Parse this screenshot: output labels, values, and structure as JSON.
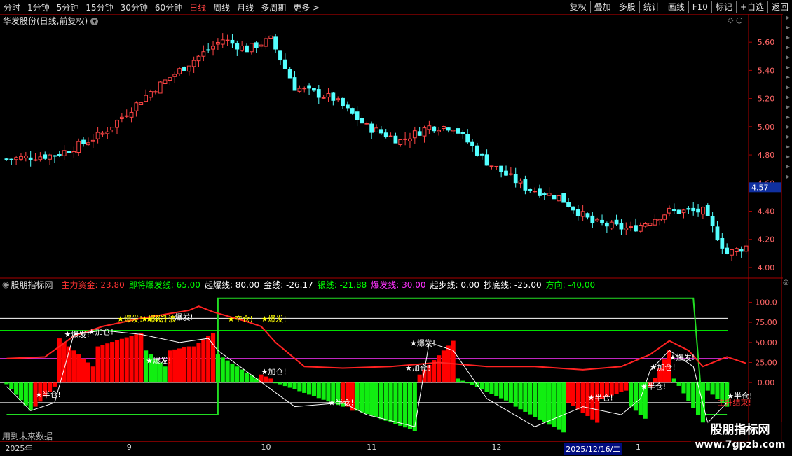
{
  "toolbar": {
    "periods": [
      "分时",
      "1分钟",
      "5分钟",
      "15分钟",
      "30分钟",
      "60分钟",
      "日线",
      "周线",
      "月线",
      "多周期",
      "更多 >"
    ],
    "active_period": "日线",
    "buttons": [
      "复权",
      "叠加",
      "多股",
      "统计",
      "画线",
      "F10",
      "标记",
      "+自选",
      "返回"
    ]
  },
  "kline": {
    "title": "华发股份(日线,前复权)",
    "price_axis": [
      "5.60",
      "5.40",
      "5.20",
      "5.00",
      "4.80",
      "4.60",
      "4.40",
      "4.20",
      "4.00"
    ],
    "current_price": "4.57",
    "ylim": [
      3.95,
      5.75
    ],
    "up_color": "#ff4444",
    "down_color": "#54ffff"
  },
  "indicator": {
    "name": "股朋指标网",
    "values": [
      {
        "label": "主力资金: 23.80",
        "color": "#ff3333"
      },
      {
        "label": "即将爆发线: 65.00",
        "color": "#00ff00"
      },
      {
        "label": "起爆线: 80.00",
        "color": "#ffffff"
      },
      {
        "label": "金线: -26.17",
        "color": "#ffffff"
      },
      {
        "label": "银线: -21.88",
        "color": "#00ff00"
      },
      {
        "label": "爆发线: 30.00",
        "color": "#ff33ff"
      },
      {
        "label": "起步线: 0.00",
        "color": "#ffffff"
      },
      {
        "label": "抄底线: -25.00",
        "color": "#ffffff"
      },
      {
        "label": "方向: -40.00",
        "color": "#00ff00"
      }
    ],
    "axis": [
      "100.0",
      "75.00",
      "50.00",
      "25.00",
      "0.00"
    ],
    "ylim": [
      -60,
      110
    ],
    "signals": [
      {
        "text": "★半仓!",
        "bar": 6,
        "v": -18,
        "color": "#ffffff"
      },
      {
        "text": "★爆发!",
        "bar": 12,
        "v": 57,
        "color": "#ffffff"
      },
      {
        "text": "★加仓!",
        "bar": 17,
        "v": 60,
        "color": "#ffffff"
      },
      {
        "text": "★爆发!",
        "bar": 23,
        "v": 76,
        "color": "#ffff00"
      },
      {
        "text": "★爆发!",
        "bar": 28,
        "v": 76,
        "color": "#ffff00"
      },
      {
        "text": "★主升浪",
        "bar": 29,
        "v": 76,
        "color": "#ffff00"
      },
      {
        "text": "爆发!",
        "bar": 35,
        "v": 78,
        "color": "#ffffff"
      },
      {
        "text": "★爆发!",
        "bar": 29,
        "v": 24,
        "color": "#ffffff"
      },
      {
        "text": "★空仓!",
        "bar": 46,
        "v": 76,
        "color": "#ffff00"
      },
      {
        "text": "★爆发!",
        "bar": 53,
        "v": 76,
        "color": "#ffff00"
      },
      {
        "text": "★加仓!",
        "bar": 53,
        "v": 10,
        "color": "#ffffff"
      },
      {
        "text": "★半仓!",
        "bar": 67,
        "v": -28,
        "color": "#ffffff"
      },
      {
        "text": "★爆发!",
        "bar": 84,
        "v": 46,
        "color": "#ffffff"
      },
      {
        "text": "★加仓!",
        "bar": 83,
        "v": 15,
        "color": "#ffffff"
      },
      {
        "text": "★半仓!",
        "bar": 121,
        "v": -22,
        "color": "#ffffff"
      },
      {
        "text": "★半仓!",
        "bar": 132,
        "v": -8,
        "color": "#ffffff"
      },
      {
        "text": "★加仓!",
        "bar": 134,
        "v": 16,
        "color": "#ffffff"
      },
      {
        "text": "★爆发!",
        "bar": 138,
        "v": 28,
        "color": "#ffffff"
      },
      {
        "text": "★半仓!",
        "bar": 150,
        "v": -20,
        "color": "#ffffff"
      },
      {
        "text": "主升结束!",
        "bar": 148,
        "v": -28,
        "color": "#ff3333"
      }
    ]
  },
  "footer_note": "用到未来数据",
  "date_axis": [
    {
      "label": "2025年",
      "bar": 0
    },
    {
      "label": "9",
      "bar": 25
    },
    {
      "label": "10",
      "bar": 53
    },
    {
      "label": "11",
      "bar": 75
    },
    {
      "label": "12",
      "bar": 101
    },
    {
      "label": "2025/12/16/二",
      "bar": 116,
      "selected": true
    },
    {
      "label": "1",
      "bar": 131
    }
  ],
  "watermark": {
    "line1": "股朋指标网",
    "line2": "www.7gpzb.com"
  }
}
